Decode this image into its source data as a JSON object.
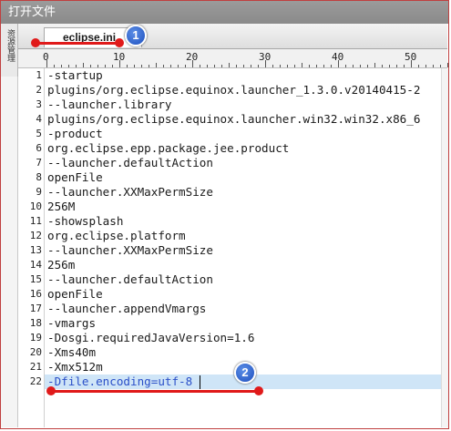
{
  "window": {
    "title": "打开文件"
  },
  "side_panel": {
    "label": "资源管理"
  },
  "tabs": [
    {
      "label": "eclipse.ini",
      "close": "✕"
    }
  ],
  "ruler": {
    "marks": [
      "0",
      "10",
      "20",
      "30",
      "40",
      "50"
    ]
  },
  "badges": {
    "one": "1",
    "two": "2"
  },
  "editor": {
    "lines": [
      "-startup",
      "plugins/org.eclipse.equinox.launcher_1.3.0.v20140415-2",
      "--launcher.library",
      "plugins/org.eclipse.equinox.launcher.win32.win32.x86_6",
      "-product",
      "org.eclipse.epp.package.jee.product",
      "--launcher.defaultAction",
      "openFile",
      "--launcher.XXMaxPermSize",
      "256M",
      "-showsplash",
      "org.eclipse.platform",
      "--launcher.XXMaxPermSize",
      "256m",
      "--launcher.defaultAction",
      "openFile",
      "--launcher.appendVmargs",
      "-vmargs",
      "-Dosgi.requiredJavaVersion=1.6",
      "-Xms40m",
      "-Xmx512m",
      "-Dfile.encoding=utf-8"
    ],
    "line_numbers": [
      "1",
      "2",
      "3",
      "4",
      "5",
      "6",
      "7",
      "8",
      "9",
      "10",
      "11",
      "12",
      "13",
      "14",
      "15",
      "16",
      "17",
      "18",
      "19",
      "20",
      "21",
      "22"
    ],
    "highlighted_line": 22
  },
  "colors": {
    "annotation": "#e01a1a",
    "badge": "#1d4fbf",
    "highlight": "#cfe5f7"
  }
}
